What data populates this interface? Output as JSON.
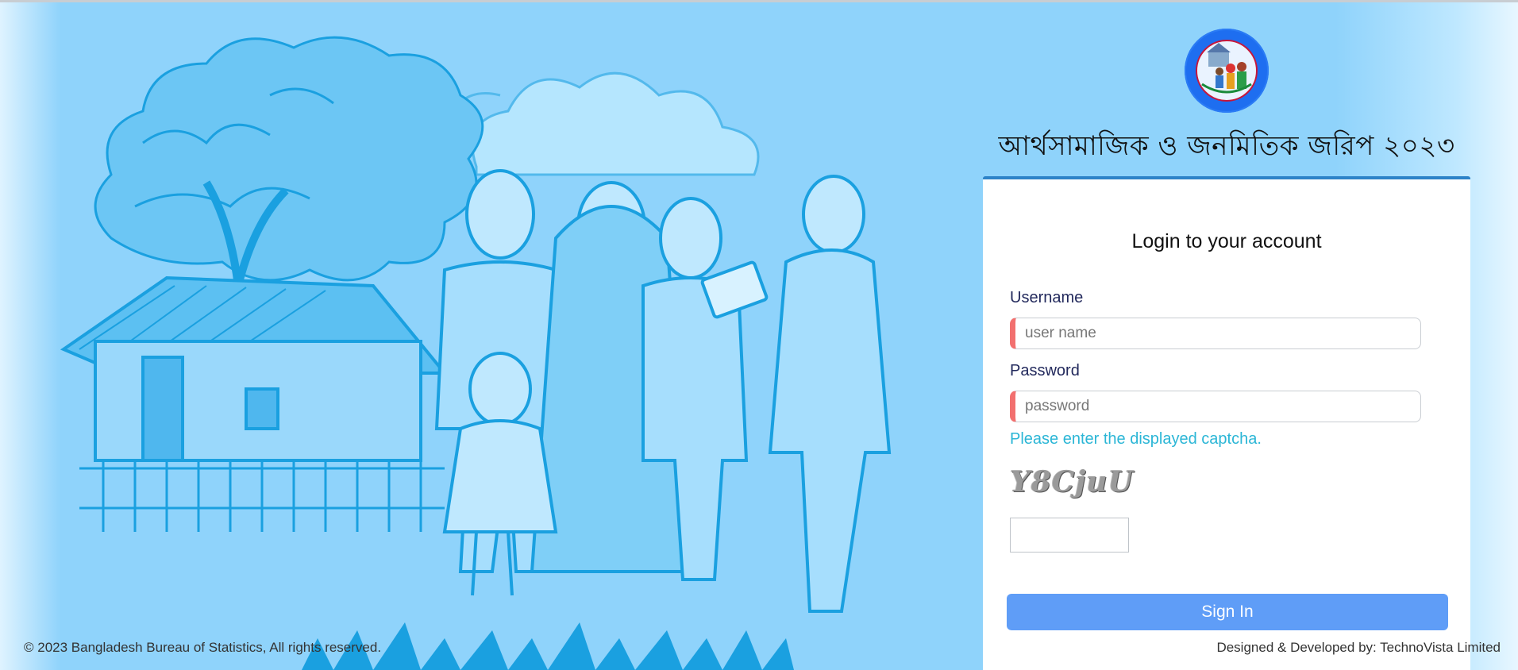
{
  "survey": {
    "title": "আর্থসামাজিক ও জনমিতিক জরিপ ২০২৩",
    "logo_icon": "bbs-survey-logo-icon"
  },
  "login": {
    "heading": "Login to your account",
    "username_label": "Username",
    "username_placeholder": "user name",
    "username_value": "",
    "password_label": "Password",
    "password_placeholder": "password",
    "password_value": "",
    "captcha_hint": "Please enter the displayed captcha.",
    "captcha_text": "Y8CjuU",
    "captcha_value": "",
    "signin_label": "Sign In"
  },
  "footer": {
    "copyright": "© 2023 Bangladesh Bureau of Statistics, All rights reserved.",
    "developer": "Designed & Developed by: TechnoVista Limited"
  },
  "colors": {
    "background": "#8fd3fb",
    "illustration_stroke": "#1aa0e0",
    "card_top_border": "#2d83c8",
    "input_accent": "#f2706f",
    "label_text": "#22295c",
    "captcha_hint": "#2bb6d6",
    "signin_button": "#5f9df7",
    "logo_blue": "#1e6ef0"
  }
}
